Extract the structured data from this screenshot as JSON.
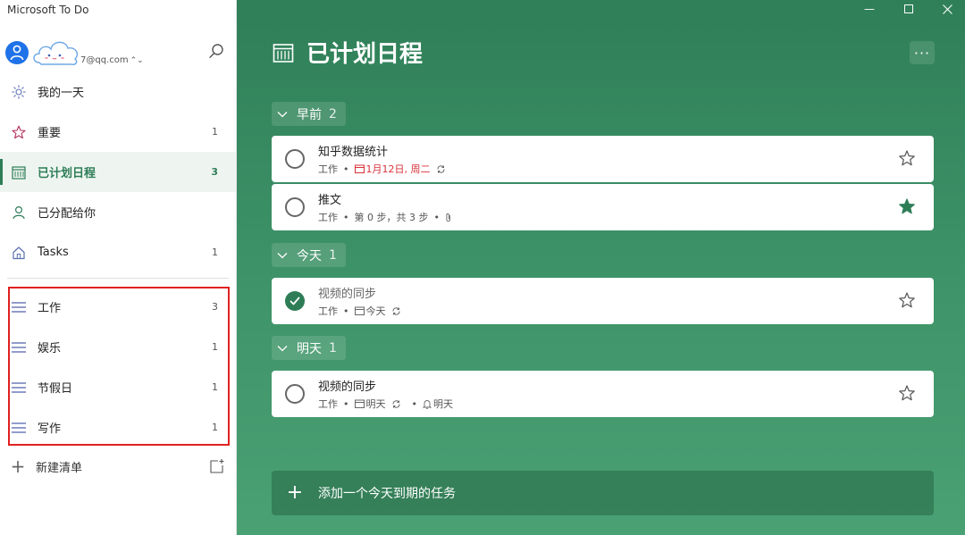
{
  "app": {
    "title": "Microsoft To Do"
  },
  "account": {
    "email": "7@qq.com"
  },
  "sidebar": {
    "nav": [
      {
        "label": "我的一天",
        "count": "",
        "icon": "sun-icon"
      },
      {
        "label": "重要",
        "count": "1",
        "icon": "star-icon"
      },
      {
        "label": "已计划日程",
        "count": "3",
        "icon": "calendar-icon",
        "active": true
      },
      {
        "label": "已分配给你",
        "count": "",
        "icon": "person-icon"
      },
      {
        "label": "Tasks",
        "count": "1",
        "icon": "home-icon"
      }
    ],
    "lists": [
      {
        "label": "工作",
        "count": "3"
      },
      {
        "label": "娱乐",
        "count": "1"
      },
      {
        "label": "节假日",
        "count": "1"
      },
      {
        "label": "写作",
        "count": "1"
      }
    ],
    "new_list_label": "新建清单"
  },
  "main": {
    "title": "已计划日程",
    "more_label": "···",
    "groups": [
      {
        "label": "早前",
        "count": "2",
        "tasks": [
          {
            "title": "知乎数据统计",
            "list": "工作",
            "due": "1月12日, 周二",
            "starred": false
          },
          {
            "title": "推文",
            "list": "工作",
            "steps": "第 0 步，共 3 步",
            "starred": true
          }
        ]
      },
      {
        "label": "今天",
        "count": "1",
        "tasks": [
          {
            "title": "视频的同步",
            "list": "工作",
            "due": "今天",
            "completed": true,
            "starred": false
          }
        ]
      },
      {
        "label": "明天",
        "count": "1",
        "tasks": [
          {
            "title": "视频的同步",
            "list": "工作",
            "due": "明天",
            "reminder": "明天",
            "starred": false
          }
        ]
      }
    ],
    "add_task_label": "添加一个今天到期的任务"
  },
  "colors": {
    "accent": "#2e7d57",
    "overdue": "#d8303a",
    "highlight_box": "#e02020"
  }
}
